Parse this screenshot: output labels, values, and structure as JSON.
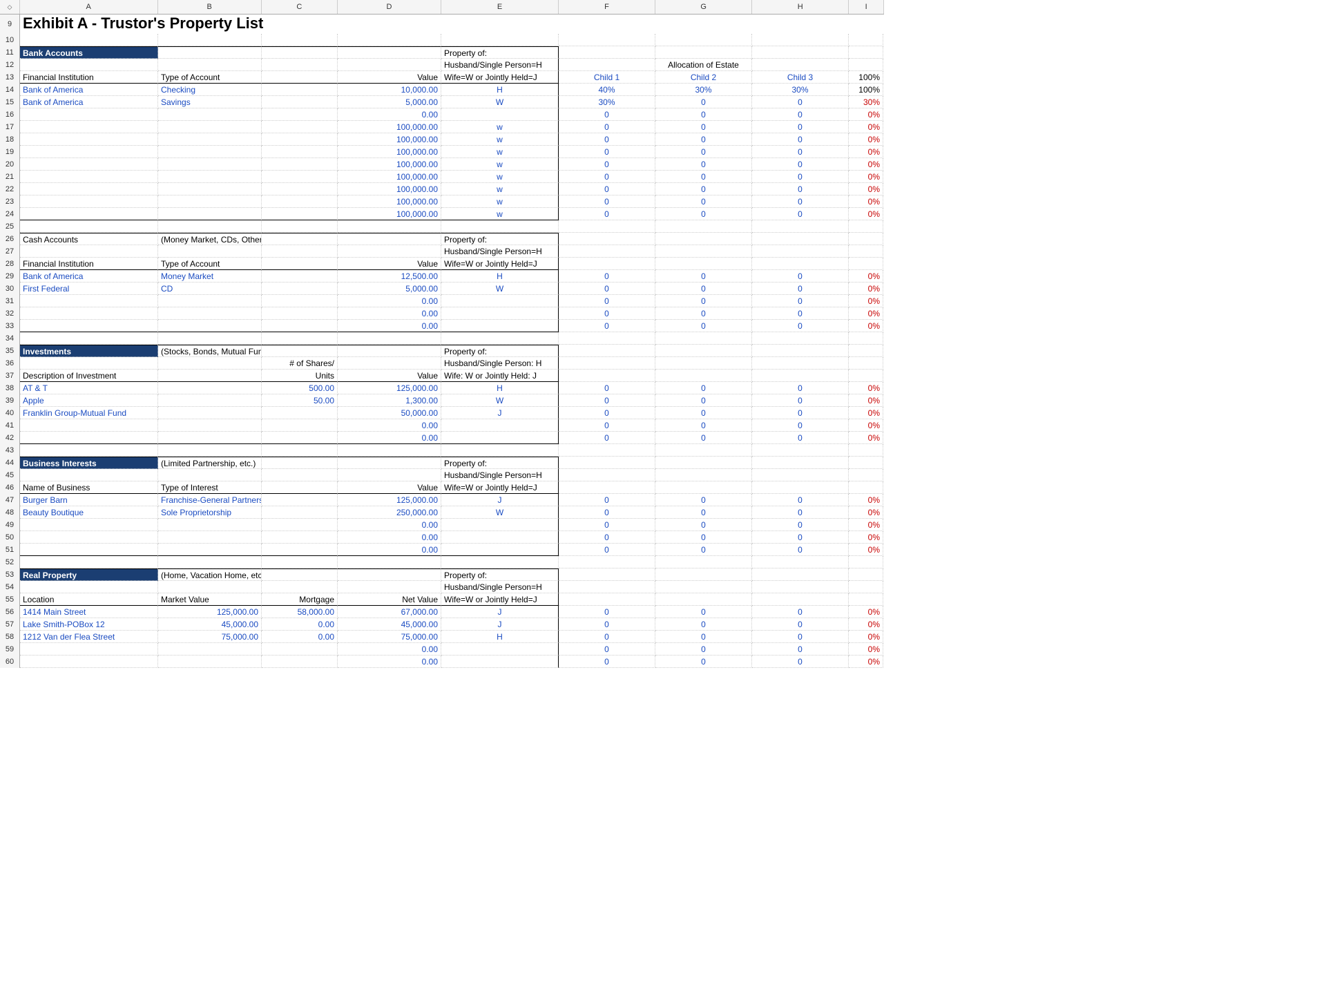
{
  "cols": [
    "A",
    "B",
    "C",
    "D",
    "E",
    "F",
    "G",
    "H",
    "I"
  ],
  "title": "Exhibit A - Trustor's Property List",
  "alloc_title": "Allocation of Estate",
  "property_of": "Property of:",
  "property_h": "Husband/Single Person=H",
  "property_w": "Wife=W or Jointly Held=J",
  "property_h2": "Husband/Single Person: H",
  "property_w2": "Wife: W or Jointly Held: J",
  "alloc_hdr": {
    "f": "Child 1",
    "g": "Child 2",
    "h": "Child 3",
    "i": "100%"
  },
  "bank": {
    "section": "Bank Accounts",
    "hA": "Financial Institution",
    "hB": "Type of Account",
    "hD": "Value",
    "rows": [
      {
        "n": 14,
        "a": "Bank of America",
        "b": "Checking",
        "d": "10,000.00",
        "e": "H",
        "f": "40%",
        "g": "30%",
        "h": "30%",
        "i": "100%",
        "iBlack": true
      },
      {
        "n": 15,
        "a": "Bank of America",
        "b": "Savings",
        "d": "5,000.00",
        "e": "W",
        "f": "30%",
        "g": "0",
        "h": "0",
        "i": "30%"
      },
      {
        "n": 16,
        "d": "0.00",
        "f": "0",
        "g": "0",
        "h": "0",
        "i": "0%"
      },
      {
        "n": 17,
        "d": "100,000.00",
        "e": "w",
        "f": "0",
        "g": "0",
        "h": "0",
        "i": "0%"
      },
      {
        "n": 18,
        "d": "100,000.00",
        "e": "w",
        "f": "0",
        "g": "0",
        "h": "0",
        "i": "0%"
      },
      {
        "n": 19,
        "d": "100,000.00",
        "e": "w",
        "f": "0",
        "g": "0",
        "h": "0",
        "i": "0%"
      },
      {
        "n": 20,
        "d": "100,000.00",
        "e": "w",
        "f": "0",
        "g": "0",
        "h": "0",
        "i": "0%"
      },
      {
        "n": 21,
        "d": "100,000.00",
        "e": "w",
        "f": "0",
        "g": "0",
        "h": "0",
        "i": "0%"
      },
      {
        "n": 22,
        "d": "100,000.00",
        "e": "w",
        "f": "0",
        "g": "0",
        "h": "0",
        "i": "0%"
      },
      {
        "n": 23,
        "d": "100,000.00",
        "e": "w",
        "f": "0",
        "g": "0",
        "h": "0",
        "i": "0%"
      },
      {
        "n": 24,
        "d": "100,000.00",
        "e": "w",
        "f": "0",
        "g": "0",
        "h": "0",
        "i": "0%"
      }
    ]
  },
  "cash": {
    "section": "Cash Accounts",
    "note": "(Money Market, CDs, Other)",
    "hA": "Financial Institution",
    "hB": "Type of Account",
    "hD": "Value",
    "rows": [
      {
        "n": 29,
        "a": "Bank of America",
        "b": "Money Market",
        "d": "12,500.00",
        "e": "H",
        "f": "0",
        "g": "0",
        "h": "0",
        "i": "0%"
      },
      {
        "n": 30,
        "a": "First Federal",
        "b": "CD",
        "d": "5,000.00",
        "e": "W",
        "f": "0",
        "g": "0",
        "h": "0",
        "i": "0%"
      },
      {
        "n": 31,
        "d": "0.00",
        "f": "0",
        "g": "0",
        "h": "0",
        "i": "0%"
      },
      {
        "n": 32,
        "d": "0.00",
        "f": "0",
        "g": "0",
        "h": "0",
        "i": "0%"
      },
      {
        "n": 33,
        "d": "0.00",
        "f": "0",
        "g": "0",
        "h": "0",
        "i": "0%"
      }
    ]
  },
  "inv": {
    "section": "Investments",
    "note": "(Stocks, Bonds, Mutual Funds, Other)",
    "hA": "Description of Investment",
    "hC1": "# of Shares/",
    "hC2": "Units",
    "hD": "Value",
    "rows": [
      {
        "n": 38,
        "a": "AT & T",
        "c": "500.00",
        "d": "125,000.00",
        "e": "H",
        "f": "0",
        "g": "0",
        "h": "0",
        "i": "0%"
      },
      {
        "n": 39,
        "a": "Apple",
        "c": "50.00",
        "d": "1,300.00",
        "e": "W",
        "f": "0",
        "g": "0",
        "h": "0",
        "i": "0%"
      },
      {
        "n": 40,
        "a": "Franklin Group-Mutual Fund",
        "d": "50,000.00",
        "e": "J",
        "f": "0",
        "g": "0",
        "h": "0",
        "i": "0%"
      },
      {
        "n": 41,
        "d": "0.00",
        "f": "0",
        "g": "0",
        "h": "0",
        "i": "0%"
      },
      {
        "n": 42,
        "d": "0.00",
        "f": "0",
        "g": "0",
        "h": "0",
        "i": "0%"
      }
    ]
  },
  "biz": {
    "section": "Business Interests",
    "note": "(Limited Partnership, etc.)",
    "hA": "Name of Business",
    "hB": "Type of Interest",
    "hD": "Value",
    "rows": [
      {
        "n": 47,
        "a": "Burger Barn",
        "b": "Franchise-General Partnership",
        "d": "125,000.00",
        "e": "J",
        "f": "0",
        "g": "0",
        "h": "0",
        "i": "0%"
      },
      {
        "n": 48,
        "a": "Beauty Boutique",
        "b": "Sole Proprietorship",
        "d": "250,000.00",
        "e": "W",
        "f": "0",
        "g": "0",
        "h": "0",
        "i": "0%"
      },
      {
        "n": 49,
        "d": "0.00",
        "f": "0",
        "g": "0",
        "h": "0",
        "i": "0%"
      },
      {
        "n": 50,
        "d": "0.00",
        "f": "0",
        "g": "0",
        "h": "0",
        "i": "0%"
      },
      {
        "n": 51,
        "d": "0.00",
        "f": "0",
        "g": "0",
        "h": "0",
        "i": "0%"
      }
    ]
  },
  "real": {
    "section": "Real Property",
    "note": "(Home, Vacation Home, etc.)",
    "hA": "Location",
    "hB": "Market Value",
    "hC": "Mortgage",
    "hD": "Net Value",
    "rows": [
      {
        "n": 56,
        "a": "1414 Main Street",
        "b": "125,000.00",
        "c": "58,000.00",
        "d": "67,000.00",
        "e": "J",
        "f": "0",
        "g": "0",
        "h": "0",
        "i": "0%"
      },
      {
        "n": 57,
        "a": "Lake Smith-POBox 12",
        "b": "45,000.00",
        "c": "0.00",
        "d": "45,000.00",
        "e": "J",
        "f": "0",
        "g": "0",
        "h": "0",
        "i": "0%"
      },
      {
        "n": 58,
        "a": "1212 Van der Flea Street",
        "b": "75,000.00",
        "c": "0.00",
        "d": "75,000.00",
        "e": "H",
        "f": "0",
        "g": "0",
        "h": "0",
        "i": "0%"
      },
      {
        "n": 59,
        "d": "0.00",
        "f": "0",
        "g": "0",
        "h": "0",
        "i": "0%"
      },
      {
        "n": 60,
        "d": "0.00",
        "f": "0",
        "g": "0",
        "h": "0",
        "i": "0%"
      }
    ]
  }
}
